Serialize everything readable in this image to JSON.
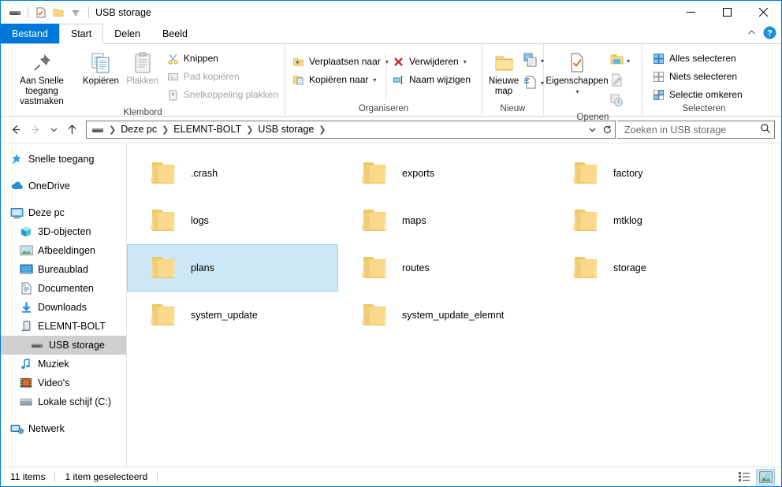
{
  "window": {
    "title": "USB storage",
    "quick_access": [
      "drive-icon",
      "properties-icon",
      "new-folder-icon",
      "customize-dropdown-icon"
    ],
    "controls": {
      "minimize": "minimize-icon",
      "maximize": "maximize-icon",
      "close": "close-icon"
    }
  },
  "tabs": {
    "file": "Bestand",
    "items": [
      {
        "label": "Start",
        "active": true
      },
      {
        "label": "Delen",
        "active": false
      },
      {
        "label": "Beeld",
        "active": false
      }
    ],
    "collapse": "collapse-ribbon-icon",
    "help": "help-icon"
  },
  "ribbon": {
    "groups": [
      {
        "title": "Klembord",
        "big": [
          {
            "label": "Aan Snelle toegang vastmaken",
            "icon": "pin-icon",
            "disabled": false
          },
          {
            "label": "Kopiëren",
            "icon": "copy-icon",
            "disabled": false
          },
          {
            "label": "Plakken",
            "icon": "paste-icon",
            "disabled": true
          }
        ],
        "small": [
          {
            "label": "Knippen",
            "icon": "scissors-icon",
            "disabled": false
          },
          {
            "label": "Pad kopiëren",
            "icon": "copy-path-icon",
            "disabled": true
          },
          {
            "label": "Snelkoppeling plakken",
            "icon": "paste-shortcut-icon",
            "disabled": true
          }
        ]
      },
      {
        "title": "Organiseren",
        "small_left": [
          {
            "label": "Verplaatsen naar",
            "icon": "move-to-icon",
            "caret": true
          },
          {
            "label": "Kopiëren naar",
            "icon": "copy-to-icon",
            "caret": true
          }
        ],
        "small_right": [
          {
            "label": "Verwijderen",
            "icon": "delete-icon",
            "caret": true
          },
          {
            "label": "Naam wijzigen",
            "icon": "rename-icon",
            "caret": false
          }
        ]
      },
      {
        "title": "Nieuw",
        "big": [
          {
            "label": "Nieuwe map",
            "icon": "new-folder-icon",
            "disabled": false
          }
        ],
        "stack": [
          {
            "label": "Nieuw item",
            "icon": "new-item-icon",
            "caret": true
          },
          {
            "label": "Snelle toegang",
            "icon": "easy-access-icon",
            "caret": true
          }
        ]
      },
      {
        "title": "Openen",
        "big": [
          {
            "label": "Eigenschappen",
            "icon": "properties-icon",
            "caret": true,
            "disabled": false
          }
        ],
        "stack": [
          {
            "label": "Openen",
            "icon": "open-folder-icon",
            "caret": true,
            "disabled": false
          },
          {
            "label": "Bewerken",
            "icon": "edit-icon",
            "caret": false,
            "disabled": true
          },
          {
            "label": "Geschiedenis",
            "icon": "history-icon",
            "caret": false,
            "disabled": true
          }
        ]
      },
      {
        "title": "Selecteren",
        "small": [
          {
            "label": "Alles selecteren",
            "icon": "select-all-icon",
            "disabled": false
          },
          {
            "label": "Niets selecteren",
            "icon": "select-none-icon",
            "disabled": false
          },
          {
            "label": "Selectie omkeren",
            "icon": "invert-selection-icon",
            "disabled": false
          }
        ]
      }
    ]
  },
  "navbar": {
    "back": "back-arrow-icon",
    "forward": "forward-arrow-icon",
    "recent": "recent-locations-icon",
    "up": "up-arrow-icon",
    "breadcrumbs": [
      "Deze pc",
      "ELEMNT-BOLT",
      "USB storage"
    ],
    "dropdown": "address-dropdown-icon",
    "refresh": "refresh-icon",
    "search_placeholder": "Zoeken in USB storage",
    "search_value": "",
    "search_icon": "search-icon"
  },
  "sidebar": {
    "items": [
      {
        "label": "Snelle toegang",
        "icon": "quick-access-star-icon",
        "level": 0,
        "selected": false
      },
      {
        "label": "OneDrive",
        "icon": "onedrive-cloud-icon",
        "level": 0,
        "selected": false,
        "gap_before": true
      },
      {
        "label": "Deze pc",
        "icon": "this-pc-icon",
        "level": 0,
        "selected": false,
        "gap_before": true
      },
      {
        "label": "3D-objecten",
        "icon": "3d-objects-icon",
        "level": 1,
        "selected": false
      },
      {
        "label": "Afbeeldingen",
        "icon": "pictures-icon",
        "level": 1,
        "selected": false
      },
      {
        "label": "Bureaublad",
        "icon": "desktop-icon",
        "level": 1,
        "selected": false
      },
      {
        "label": "Documenten",
        "icon": "documents-icon",
        "level": 1,
        "selected": false
      },
      {
        "label": "Downloads",
        "icon": "downloads-icon",
        "level": 1,
        "selected": false
      },
      {
        "label": "ELEMNT-BOLT",
        "icon": "portable-device-icon",
        "level": 1,
        "selected": false
      },
      {
        "label": "USB storage",
        "icon": "usb-drive-icon",
        "level": 2,
        "selected": true
      },
      {
        "label": "Muziek",
        "icon": "music-icon",
        "level": 1,
        "selected": false
      },
      {
        "label": "Video's",
        "icon": "videos-icon",
        "level": 1,
        "selected": false
      },
      {
        "label": "Lokale schijf (C:)",
        "icon": "local-disk-icon",
        "level": 1,
        "selected": false
      },
      {
        "label": "Netwerk",
        "icon": "network-icon",
        "level": 0,
        "selected": false,
        "gap_before": true
      }
    ]
  },
  "files": {
    "items": [
      {
        "name": ".crash",
        "icon": "folder-icon",
        "selected": false
      },
      {
        "name": "exports",
        "icon": "folder-icon",
        "selected": false
      },
      {
        "name": "factory",
        "icon": "folder-icon",
        "selected": false
      },
      {
        "name": "logs",
        "icon": "folder-icon",
        "selected": false
      },
      {
        "name": "maps",
        "icon": "folder-icon",
        "selected": false
      },
      {
        "name": "mtklog",
        "icon": "folder-icon",
        "selected": false
      },
      {
        "name": "plans",
        "icon": "folder-icon",
        "selected": true
      },
      {
        "name": "routes",
        "icon": "folder-icon",
        "selected": false
      },
      {
        "name": "storage",
        "icon": "folder-icon",
        "selected": false
      },
      {
        "name": "system_update",
        "icon": "folder-icon",
        "selected": false
      },
      {
        "name": "system_update_elemnt",
        "icon": "folder-icon",
        "selected": false
      }
    ]
  },
  "statusbar": {
    "item_count": "11 items",
    "selection": "1 item geselecteerd",
    "views": [
      {
        "name": "details-view-button",
        "active": false
      },
      {
        "name": "large-icons-view-button",
        "active": true
      }
    ]
  },
  "colors": {
    "accent": "#0078d7",
    "selection_fill": "#cce8f7",
    "selection_border": "#99d1f0",
    "folder_yellow": "#fce08a",
    "nav_selected": "#cfcfcf"
  }
}
